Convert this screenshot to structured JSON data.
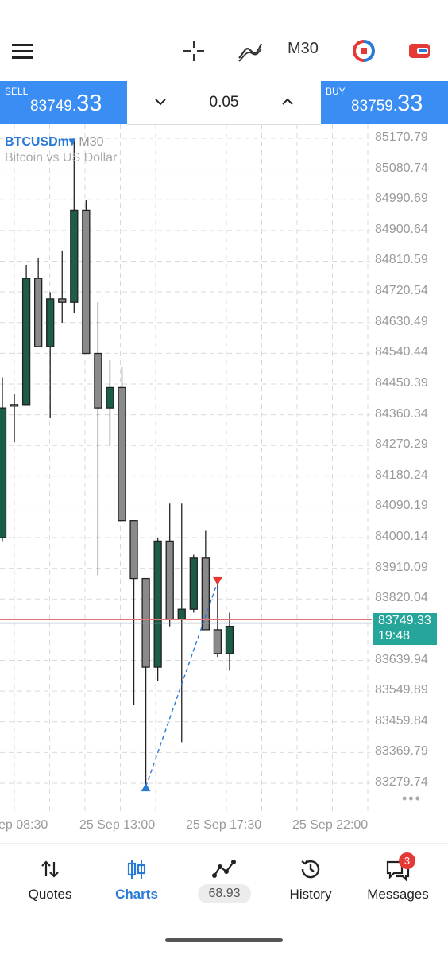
{
  "toolbar": {
    "menu_icon": "hamburger-icon",
    "crosshair_icon": "crosshair-icon",
    "indicator_icon": "indicators-icon",
    "timeframe": "M30",
    "trade_icon": "one-click-trade-icon",
    "account_icon": "account-icon"
  },
  "trade": {
    "sell_label": "SELL",
    "sell_price_prefix": "83749.",
    "sell_price_big": "33",
    "volume": "0.05",
    "buy_label": "BUY",
    "buy_price_prefix": "83759.",
    "buy_price_big": "33"
  },
  "chart": {
    "symbol": "BTCUSDm",
    "dropdown": "▾",
    "timeframe": "M30",
    "description": "Bitcoin vs US Dollar",
    "current_price": "83749.33",
    "countdown": "19:48",
    "price_labels": [
      "85170.79",
      "85080.74",
      "84990.69",
      "84900.64",
      "84810.59",
      "84720.54",
      "84630.49",
      "84540.44",
      "84450.39",
      "84360.34",
      "84270.29",
      "84180.24",
      "84090.19",
      "84000.14",
      "83910.09",
      "83820.04",
      "83639.94",
      "83549.89",
      "83459.84",
      "83369.79",
      "83279.74"
    ],
    "time_labels": [
      "ep 08:30",
      "25 Sep 13:00",
      "25 Sep 17:30",
      "25 Sep 22:00"
    ],
    "more": "•••"
  },
  "chart_data": {
    "type": "candlestick",
    "symbol": "BTCUSDm",
    "timeframe": "M30",
    "ylim": [
      83230,
      85190
    ],
    "bull_color": "#1b5e45",
    "bear_color": "#8a8a8a",
    "candles": [
      {
        "o": 84000,
        "h": 84470,
        "l": 83990,
        "c": 84380,
        "bull": true
      },
      {
        "o": 84390,
        "h": 84420,
        "l": 84280,
        "c": 84390,
        "bull": false
      },
      {
        "o": 84390,
        "h": 84800,
        "l": 84390,
        "c": 84760,
        "bull": true
      },
      {
        "o": 84760,
        "h": 84820,
        "l": 84560,
        "c": 84560,
        "bull": false
      },
      {
        "o": 84560,
        "h": 84720,
        "l": 84350,
        "c": 84700,
        "bull": true
      },
      {
        "o": 84700,
        "h": 84840,
        "l": 84630,
        "c": 84690,
        "bull": false
      },
      {
        "o": 84690,
        "h": 85170,
        "l": 84660,
        "c": 84960,
        "bull": true
      },
      {
        "o": 84960,
        "h": 84990,
        "l": 84540,
        "c": 84540,
        "bull": false
      },
      {
        "o": 84540,
        "h": 84690,
        "l": 83890,
        "c": 84380,
        "bull": false
      },
      {
        "o": 84380,
        "h": 84520,
        "l": 84270,
        "c": 84440,
        "bull": true
      },
      {
        "o": 84440,
        "h": 84500,
        "l": 84050,
        "c": 84050,
        "bull": false
      },
      {
        "o": 84050,
        "h": 84050,
        "l": 83510,
        "c": 83880,
        "bull": false
      },
      {
        "o": 83880,
        "h": 83880,
        "l": 83270,
        "c": 83620,
        "bull": false
      },
      {
        "o": 83620,
        "h": 84000,
        "l": 83580,
        "c": 83990,
        "bull": true
      },
      {
        "o": 83990,
        "h": 84100,
        "l": 83740,
        "c": 83760,
        "bull": false
      },
      {
        "o": 83760,
        "h": 84100,
        "l": 83400,
        "c": 83790,
        "bull": true
      },
      {
        "o": 83790,
        "h": 83950,
        "l": 83780,
        "c": 83940,
        "bull": true
      },
      {
        "o": 83940,
        "h": 84020,
        "l": 83760,
        "c": 83730,
        "bull": false
      },
      {
        "o": 83730,
        "h": 83880,
        "l": 83650,
        "c": 83660,
        "bull": false
      },
      {
        "o": 83660,
        "h": 83780,
        "l": 83610,
        "c": 83740,
        "bull": true
      }
    ]
  },
  "nav": {
    "quotes": "Quotes",
    "charts": "Charts",
    "metric": "68.93",
    "history": "History",
    "messages": "Messages",
    "messages_badge": "3"
  }
}
